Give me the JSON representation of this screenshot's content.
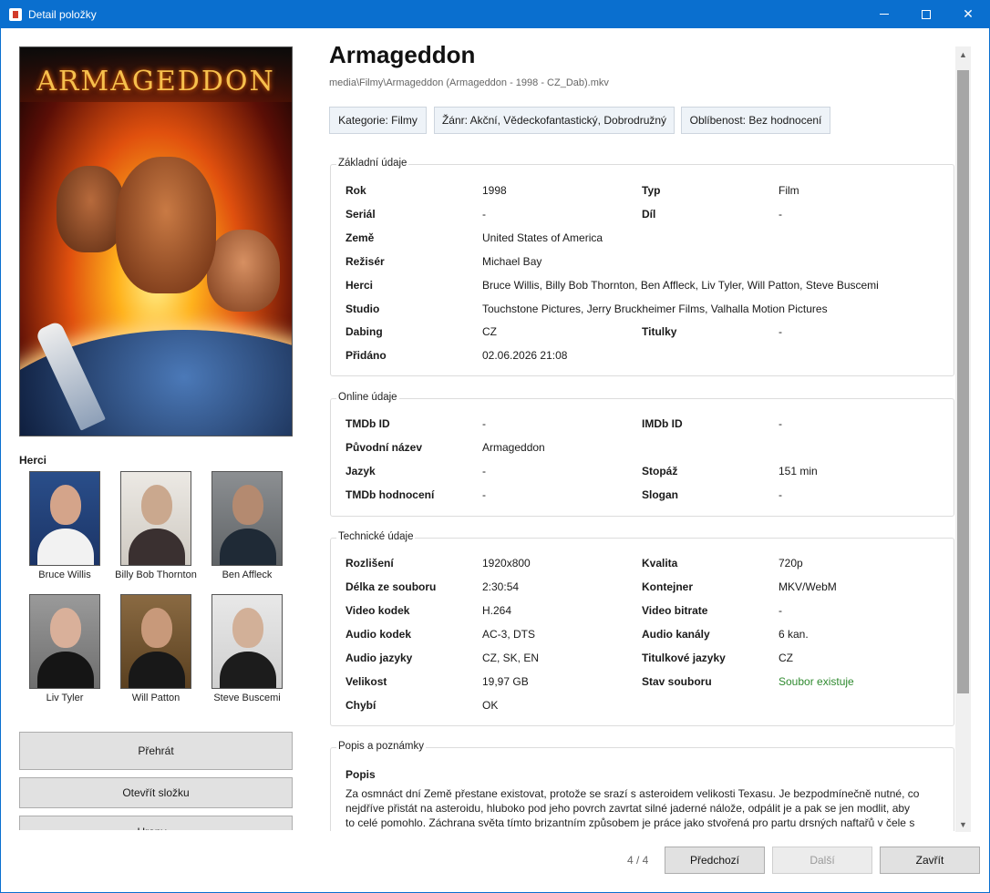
{
  "window": {
    "title": "Detail položky",
    "minimize_icon": "minimize-icon",
    "maximize_icon": "maximize-icon",
    "close_icon": "close-icon"
  },
  "poster": {
    "title_text": "ARMAGEDDON"
  },
  "cast": {
    "heading": "Herci",
    "actors": [
      {
        "name": "Bruce Willis"
      },
      {
        "name": "Billy Bob Thornton"
      },
      {
        "name": "Ben Affleck"
      },
      {
        "name": "Liv Tyler"
      },
      {
        "name": "Will Patton"
      },
      {
        "name": "Steve Buscemi"
      }
    ]
  },
  "actions": {
    "play": "Přehrát",
    "open_folder": "Otevřít složku",
    "third": "Hrany..."
  },
  "movie": {
    "title": "Armageddon",
    "path": "media\\Filmy\\Armageddon (Armageddon - 1998 - CZ_Dab).mkv",
    "tags": [
      "Kategorie: Filmy",
      "Žánr: Akční, Vědeckofantastický, Dobrodružný",
      "Oblíbenost: Bez hodnocení"
    ]
  },
  "basic": {
    "title": "Základní údaje",
    "rows": [
      {
        "l1": "Rok",
        "v1": "1998",
        "l2": "Typ",
        "v2": "Film"
      },
      {
        "l1": "Seriál",
        "v1": "-",
        "l2": "Díl",
        "v2": "-"
      },
      {
        "l1": "Země",
        "v1": "United States of America",
        "l2": "",
        "v2": ""
      },
      {
        "l1": "Režisér",
        "v1": "Michael Bay",
        "l2": "",
        "v2": ""
      },
      {
        "l1": "Herci",
        "v1": "Bruce Willis, Billy Bob Thornton, Ben Affleck, Liv Tyler, Will Patton, Steve Buscemi",
        "l2": "",
        "v2": ""
      },
      {
        "l1": "Studio",
        "v1": "Touchstone Pictures, Jerry Bruckheimer Films, Valhalla Motion Pictures",
        "l2": "",
        "v2": ""
      },
      {
        "l1": "Dabing",
        "v1": "CZ",
        "l2": "Titulky",
        "v2": "-"
      },
      {
        "l1": "Přidáno",
        "v1": "02.06.2026 21:08",
        "l2": "",
        "v2": ""
      }
    ]
  },
  "online": {
    "title": "Online údaje",
    "rows": [
      {
        "l1": "TMDb ID",
        "v1": "-",
        "l2": "IMDb ID",
        "v2": "-"
      },
      {
        "l1": "Původní název",
        "v1": "Armageddon",
        "l2": "",
        "v2": ""
      },
      {
        "l1": "Jazyk",
        "v1": "-",
        "l2": "Stopáž",
        "v2": "151 min"
      },
      {
        "l1": "TMDb hodnocení",
        "v1": "-",
        "l2": "Slogan",
        "v2": "-"
      }
    ]
  },
  "technical": {
    "title": "Technické údaje",
    "rows": [
      {
        "l1": "Rozlišení",
        "v1": "1920x800",
        "l2": "Kvalita",
        "v2": "720p"
      },
      {
        "l1": "Délka ze souboru",
        "v1": "2:30:54",
        "l2": "Kontejner",
        "v2": "MKV/WebM"
      },
      {
        "l1": "Video kodek",
        "v1": "H.264",
        "l2": "Video bitrate",
        "v2": "-"
      },
      {
        "l1": "Audio kodek",
        "v1": "AC-3, DTS",
        "l2": "Audio kanály",
        "v2": "6 kan."
      },
      {
        "l1": "Audio jazyky",
        "v1": "CZ, SK, EN",
        "l2": "Titulkové jazyky",
        "v2": "CZ"
      },
      {
        "l1": "Velikost",
        "v1": "19,97 GB",
        "l2": "Stav souboru",
        "v2": "Soubor existuje"
      },
      {
        "l1": "Chybí",
        "v1": "OK",
        "l2": "",
        "v2": ""
      }
    ]
  },
  "notes": {
    "title": "Popis a poznámky",
    "label": "Popis",
    "text": "Za osmnáct dní Země přestane existovat, protože se srazí s asteroidem velikosti Texasu. Je bezpodmínečně nutné, co nejdříve přistát na asteroidu, hluboko pod jeho povrch zavrtat silné jaderné nálože, odpálit je a pak se jen modlit, aby to celé pomohlo. Záchrana světa tímto brizantním způsobem je práce jako stvořená pro partu drsných naftařů v čele s Harrym"
  },
  "footer": {
    "counter": "4 / 4",
    "prev": "Předchozí",
    "next": "Další",
    "close": "Zavřít"
  },
  "colors": {
    "titlebar": "#0a6fcf",
    "status_ok": "#2f8a2f"
  }
}
